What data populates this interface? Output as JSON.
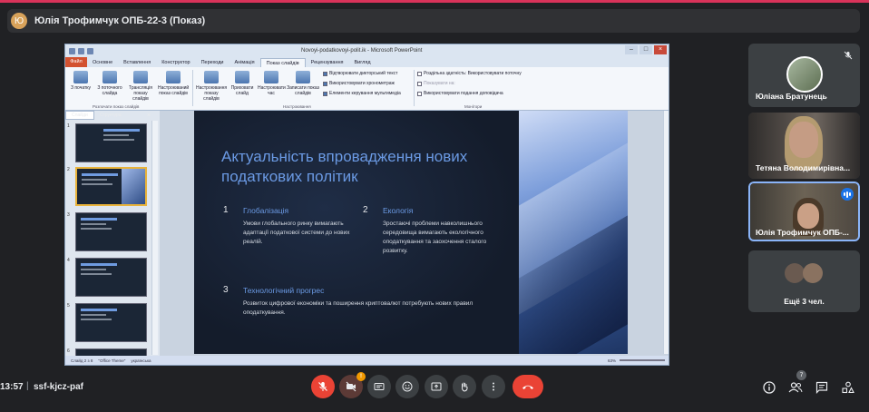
{
  "meeting": {
    "presenter_banner": "Юлія Трофимчук ОПБ-22-3 (Показ)",
    "presenter_initial": "Ю",
    "clock": "13:57",
    "code": "ssf-kjcz-paf",
    "people_count": "7",
    "cam_badge": "!"
  },
  "ppt": {
    "window_title": "Novoyi-podatkovoyi-polit.ik - Microsoft PowerPoint",
    "file_tab": "Файл",
    "tabs": [
      "Основне",
      "Вставлення",
      "Конструктор",
      "Переходи",
      "Анімація",
      "Показ слайдів",
      "Рецензування",
      "Вигляд"
    ],
    "ribbon": {
      "buttons": [
        "З початку",
        "З поточного слайда",
        "Трансляція показу слайдів",
        "Настроюваний показ слайдів",
        "Настроювання показу слайдів",
        "Приховати слайд",
        "Настроювати час",
        "Записати показ слайдів"
      ],
      "checks": [
        "Відтворювати дикторський текст",
        "Використовувати хронометраж",
        "Елементи керування мультимедіа"
      ],
      "monitor_checks": [
        "Роздільна здатність: Використовувати поточну",
        "Показувати на:",
        "Використовувати подання доповідача"
      ],
      "groups": [
        "Розпочати показ слайдів",
        "Настроювання",
        "Монітори"
      ]
    },
    "side_tabs": [
      "Слайди",
      "Структура"
    ],
    "status": [
      "Слайд 2 з 8",
      "\"Office Theme\"",
      "українська"
    ],
    "zoom": "63%"
  },
  "slide": {
    "title": "Актуальність впровадження нових податкових політик",
    "items": [
      {
        "num": "1",
        "head": "Глобалізація",
        "body": "Умови глобального ринку вимагають адаптації податкової системи до нових реалій."
      },
      {
        "num": "2",
        "head": "Екологія",
        "body": "Зростаючі проблеми навколишнього середовища вимагають екологічного оподаткування та заохочення сталого розвитку."
      },
      {
        "num": "3",
        "head": "Технологічний прогрес",
        "body": "Розвиток цифрової економіки та поширення криптовалют потребують нових правил оподаткування."
      }
    ],
    "thumb_numbers": [
      "1",
      "2",
      "3",
      "4",
      "5",
      "6"
    ]
  },
  "participants": [
    {
      "name": "Юліана Братунець"
    },
    {
      "name": "Тетяна Володимирівна..."
    },
    {
      "name": "Юлія Трофимчук ОПБ-..."
    },
    {
      "name": "Ещё 3 чел."
    }
  ],
  "colors": {
    "end_call": "#ea4335",
    "speaking": "#1a73e8",
    "slide_accent": "#6b9ae4"
  }
}
